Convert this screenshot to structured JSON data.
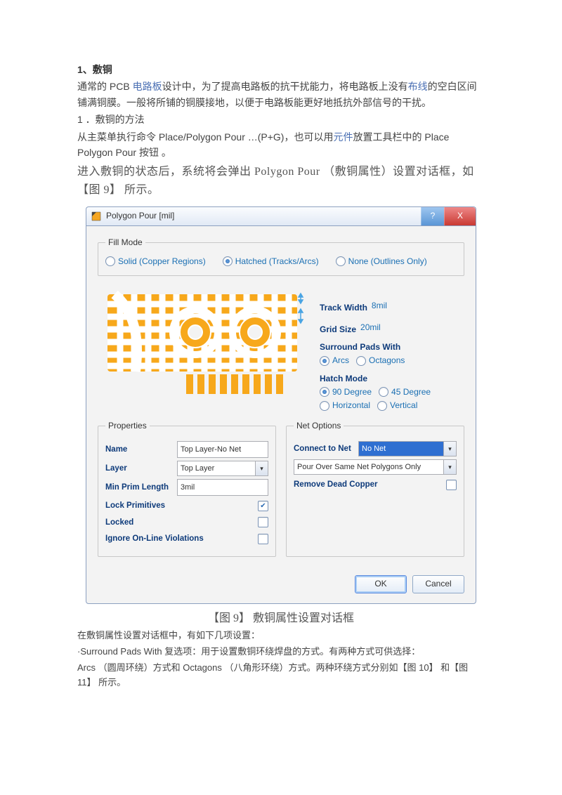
{
  "doc": {
    "heading": "1、敷铜",
    "p1_a": "通常的 PCB ",
    "p1_link1": "电路板",
    "p1_b": "设计中，为了提高电路板的抗干扰能力，将电路板上没有",
    "p1_link2": "布线",
    "p1_c": "的空白区间铺满铜膜。一般将所铺的铜膜接地，以便于电路板能更好地抵抗外部信号的干扰。",
    "p2": "1 ．敷铜的方法",
    "p3_a": "从主菜单执行命令 Place/Polygon Pour …(P+G)，也可以用",
    "p3_link": "元件",
    "p3_b": "放置工具栏中的 Place Polygon Pour 按钮 。",
    "p4": "进入敷铜的状态后，系统将会弹出 Polygon Pour （敷铜属性）设置对话框，如【图 9】 所示。",
    "caption": "【图 9】 敷铜属性设置对话框",
    "after1": "在敷铜属性设置对话框中，有如下几项设置：",
    "after2_a": "·Surround Pads With 复选项：用于设置敷铜环绕焊盘的方式。有两种方式可供选择：",
    "after3": "Arcs （圆周环绕）方式和 Octagons （八角形环绕）方式。两种环绕方式分别如【图 10】 和【图 11】 所示。"
  },
  "dialog": {
    "title": "Polygon Pour [mil]",
    "help": "?",
    "close": "X",
    "fillmode": {
      "legend": "Fill Mode",
      "solid": "Solid (Copper Regions)",
      "hatched": "Hatched (Tracks/Arcs)",
      "none": "None (Outlines Only)"
    },
    "params": {
      "trackwidth_label": "Track Width",
      "trackwidth_val": "8mil",
      "gridsize_label": "Grid Size",
      "gridsize_val": "20mil",
      "surround_header": "Surround Pads With",
      "arcs": "Arcs",
      "octagons": "Octagons",
      "hatch_header": "Hatch Mode",
      "d90": "90 Degree",
      "d45": "45 Degree",
      "horiz": "Horizontal",
      "vert": "Vertical"
    },
    "props": {
      "legend": "Properties",
      "name_label": "Name",
      "name_value": "Top Layer-No Net",
      "layer_label": "Layer",
      "layer_value": "Top Layer",
      "minprim_label": "Min Prim Length",
      "minprim_value": "3mil",
      "lockprim": "Lock Primitives",
      "locked": "Locked",
      "ignore": "Ignore On-Line Violations"
    },
    "net": {
      "legend": "Net Options",
      "connect_label": "Connect to Net",
      "connect_value": "No Net",
      "pour_value": "Pour Over Same Net Polygons Only",
      "remove_label": "Remove Dead Copper"
    },
    "buttons": {
      "ok": "OK",
      "cancel": "Cancel"
    }
  }
}
